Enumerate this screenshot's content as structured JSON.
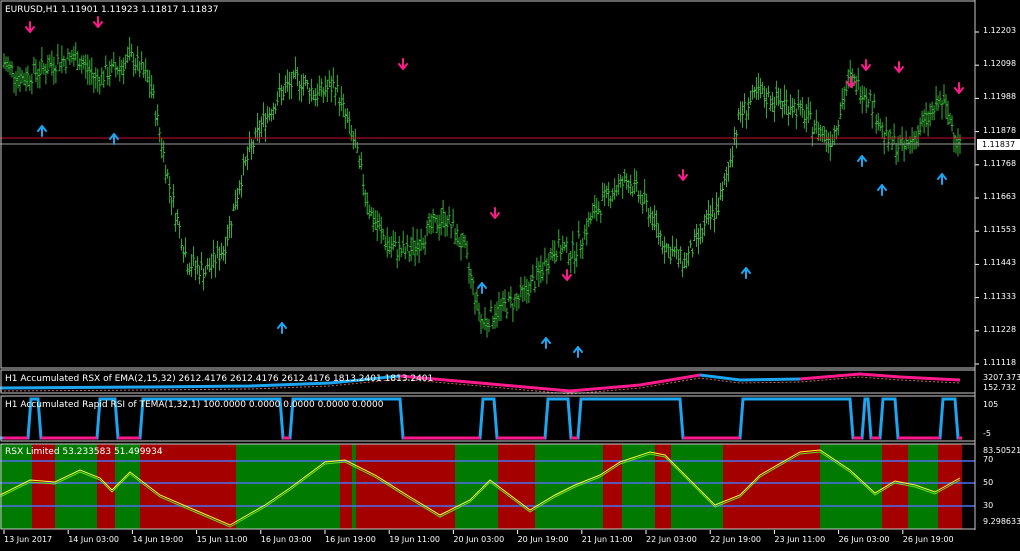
{
  "main": {
    "title": "EURUSD,H1  1.11901 1.11923 1.11817 1.11837",
    "current_price": "1.11837",
    "price_ticks": [
      "1.12203",
      "1.12098",
      "1.11988",
      "1.11878",
      "1.11768",
      "1.11663",
      "1.11553",
      "1.11443",
      "1.11333",
      "1.11228",
      "1.11118"
    ]
  },
  "panel1": {
    "title": "H1 Accumulated RSX of EMA(2,15,32) 2612.4176 2612.4176 2612.4176 1813.2401 1813.2401",
    "ticks": [
      "3207.373",
      "152.732"
    ]
  },
  "panel2": {
    "title": "H1 Accumulated Rapid RSI of TEMA(1,32,1) 100.0000 0.0000 0.0000 0.0000 0.0000",
    "ticks": [
      "105",
      "-5"
    ]
  },
  "panel3": {
    "title": "RSX Limited 53.233583 51.499934",
    "ticks": [
      "83.50521",
      "70",
      "50",
      "30",
      "9.298633"
    ]
  },
  "time_axis": [
    "13 Jun 2017",
    "14 Jun 03:00",
    "14 Jun 19:00",
    "15 Jun 11:00",
    "16 Jun 03:00",
    "16 Jun 19:00",
    "19 Jun 11:00",
    "20 Jun 03:00",
    "20 Jun 19:00",
    "21 Jun 11:00",
    "22 Jun 03:00",
    "22 Jun 19:00",
    "23 Jun 11:00",
    "26 Jun 03:00",
    "26 Jun 19:00"
  ],
  "colors": {
    "candle": "#3cbf3c",
    "up_arrow": "#1ea5f0",
    "down_arrow": "#ff1a8c",
    "zone_green": "#007a00",
    "zone_red": "#a40000",
    "line_yellow": "#ffff33",
    "line_green": "#66dd22",
    "level_blue": "#4a6ff0",
    "price_line": "#c8102e"
  },
  "chart_data": [
    {
      "type": "line",
      "title": "EURUSD,H1  1.11901 1.11923 1.11817 1.11837",
      "xlabel": "",
      "ylabel": "",
      "ylim": [
        1.11118,
        1.12203
      ],
      "x": [
        "13 Jun 2017",
        "14 Jun 03:00",
        "14 Jun 19:00",
        "15 Jun 11:00",
        "16 Jun 03:00",
        "16 Jun 19:00",
        "19 Jun 11:00",
        "20 Jun 03:00",
        "20 Jun 19:00",
        "21 Jun 11:00",
        "22 Jun 03:00",
        "22 Jun 19:00",
        "23 Jun 11:00",
        "26 Jun 03:00",
        "26 Jun 19:00"
      ],
      "series": [
        {
          "values": [
            1.121,
            1.1205,
            1.1208,
            1.1211,
            1.1212,
            1.1205,
            1.1208,
            1.1212,
            1.1203,
            1.117,
            1.1145,
            1.1142,
            1.115,
            1.1175,
            1.119,
            1.12,
            1.1205,
            1.12,
            1.1203,
            1.1185,
            1.116,
            1.115,
            1.1148,
            1.1155,
            1.116,
            1.115,
            1.1125,
            1.113,
            1.1133,
            1.114,
            1.115,
            1.1148,
            1.116,
            1.1168,
            1.1172,
            1.1163,
            1.115,
            1.1145,
            1.1155,
            1.1165,
            1.1193,
            1.12,
            1.1198,
            1.1196,
            1.119,
            1.1185,
            1.1205,
            1.12,
            1.1185,
            1.1182,
            1.119,
            1.1198,
            1.1184
          ]
        }
      ]
    }
  ]
}
